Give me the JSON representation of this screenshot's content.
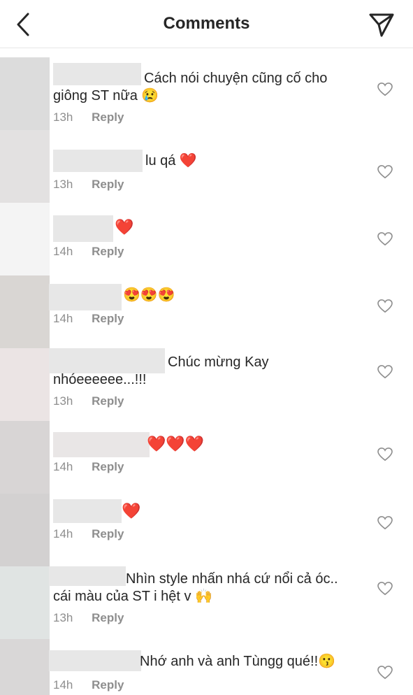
{
  "header": {
    "title": "Comments",
    "back_icon": "chevron-left-icon",
    "send_icon": "paper-plane-icon"
  },
  "comments": [
    {
      "text": "Cách nói chuyện cũng cố cho giông ST nữa 😢",
      "time": "13h",
      "reply": "Reply"
    },
    {
      "text": "lu qá ❤️",
      "time": "13h",
      "reply": "Reply"
    },
    {
      "text": "❤️",
      "time": "14h",
      "reply": "Reply"
    },
    {
      "text": "😍😍😍",
      "time": "14h",
      "reply": "Reply"
    },
    {
      "text": "Chúc mừng Kay nhóeeeeee...!!!",
      "time": "13h",
      "reply": "Reply"
    },
    {
      "text": "❤️❤️❤️",
      "time": "14h",
      "reply": "Reply"
    },
    {
      "text": "❤️",
      "time": "14h",
      "reply": "Reply"
    },
    {
      "text": "Nhìn style nhấn nhá cứ nổi cả óc.. cái màu của ST i hệt v 🙌",
      "time": "13h",
      "reply": "Reply"
    },
    {
      "text": "Nhớ anh và anh Tùngg qué!!😗",
      "time": "14h",
      "reply": "Reply"
    }
  ],
  "colors": {
    "text": "#262626",
    "meta": "#8e8e8e",
    "heart_red": "#e0102a",
    "divider": "#e6e6e6"
  }
}
